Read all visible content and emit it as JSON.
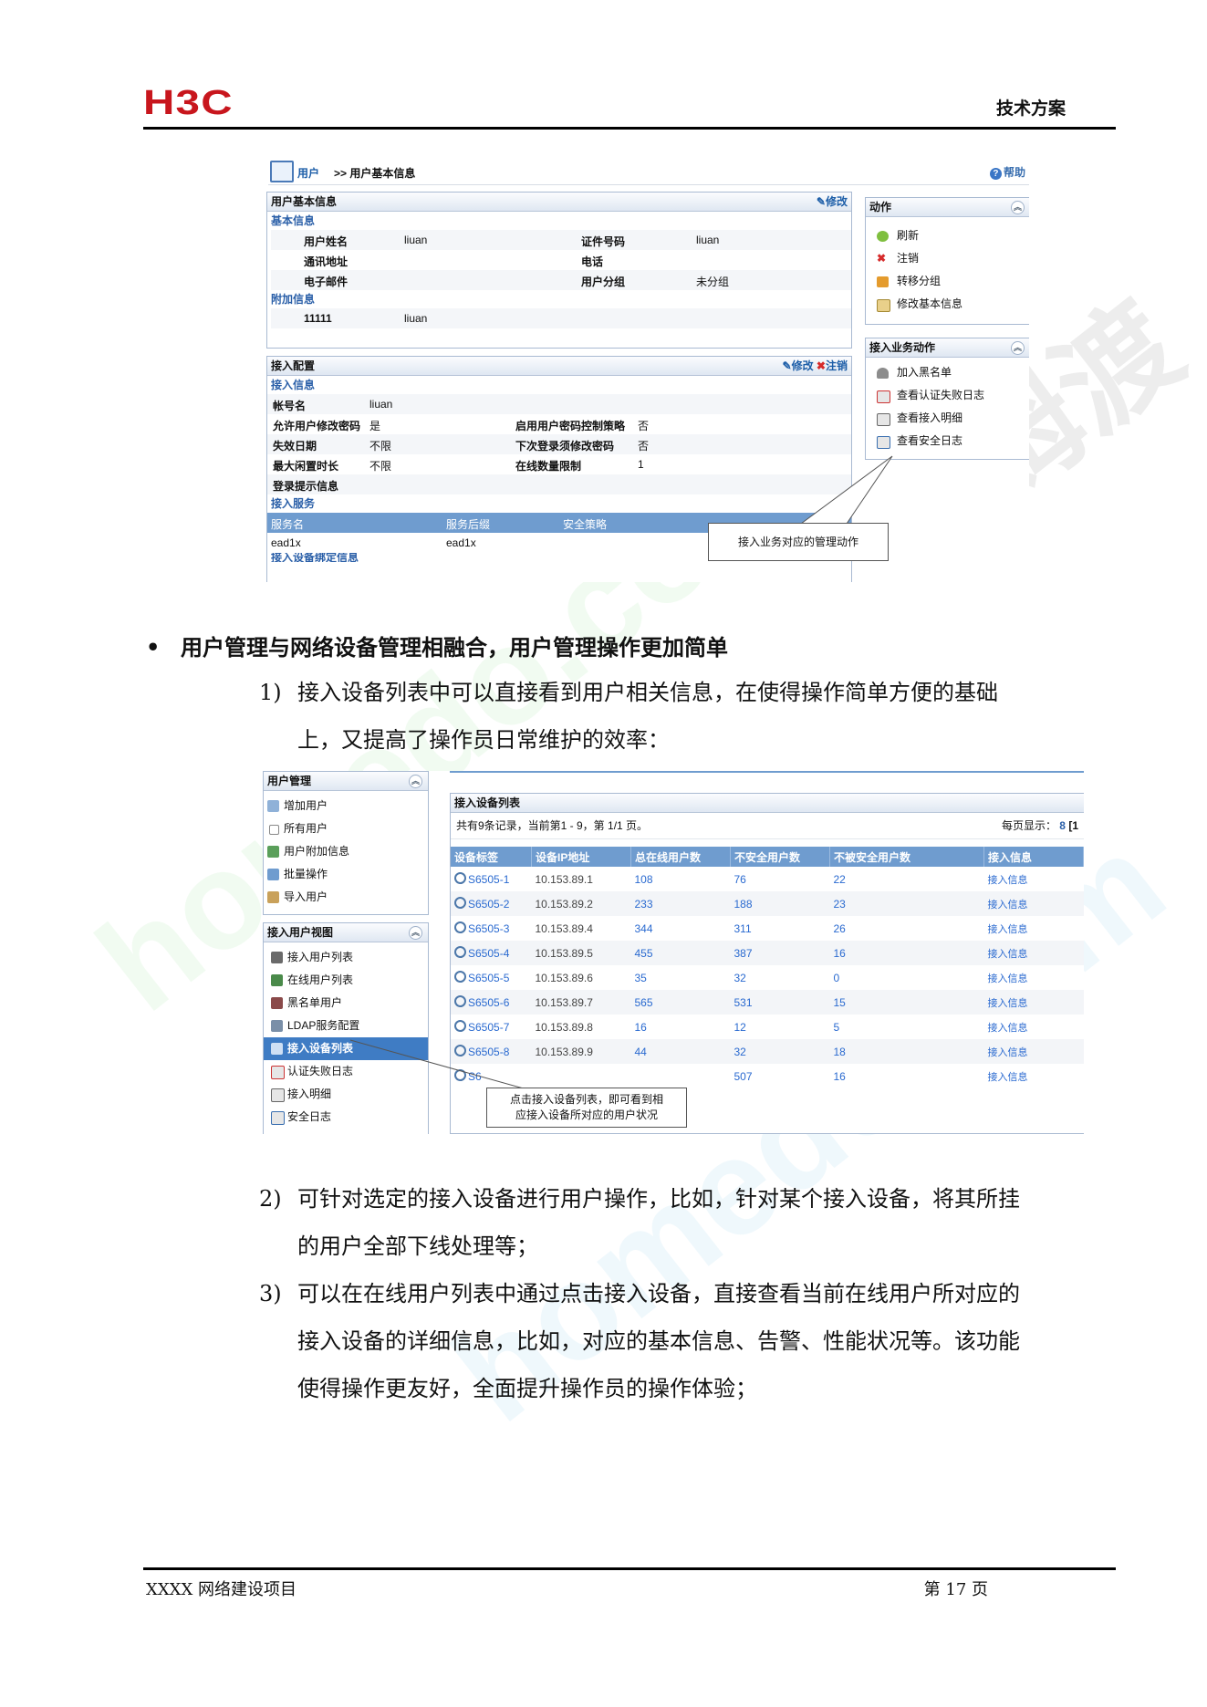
{
  "header": {
    "logo_text": "H3C",
    "doc_type": "技术方案"
  },
  "shot1": {
    "breadcrumb_link": "用户",
    "breadcrumb_current": ">> 用户基本信息",
    "help": "帮助",
    "user_panel": {
      "title": "用户基本信息",
      "edit": "修改",
      "basic_section": "基本信息",
      "rows": [
        {
          "k1": "用户姓名",
          "v1": "liuan",
          "k2": "证件号码",
          "v2": "liuan"
        },
        {
          "k1": "通讯地址",
          "v1": "",
          "k2": "电话",
          "v2": ""
        },
        {
          "k1": "电子邮件",
          "v1": "",
          "k2": "用户分组",
          "v2": "未分组"
        }
      ],
      "extra_section": "附加信息",
      "extra_row": {
        "k": "11111",
        "v": "liuan"
      }
    },
    "access_panel": {
      "title": "接入配置",
      "edit": "修改",
      "cancel": "注销",
      "info_section": "接入信息",
      "rows": [
        {
          "k1": "帐号名",
          "v1": "liuan",
          "k2": "",
          "v2": ""
        },
        {
          "k1": "允许用户修改密码",
          "v1": "是",
          "k2": "启用用户密码控制策略",
          "v2": "否"
        },
        {
          "k1": "失效日期",
          "v1": "不限",
          "k2": "下次登录须修改密码",
          "v2": "否"
        },
        {
          "k1": "最大闲置时长",
          "v1": "不限",
          "k2": "在线数量限制",
          "v2": "1"
        },
        {
          "k1": "登录提示信息",
          "v1": "",
          "k2": "",
          "v2": ""
        }
      ],
      "service_section": "接入服务",
      "service_headers": [
        "服务名",
        "服务后缀",
        "安全策略"
      ],
      "service_row": [
        "ead1x",
        "ead1x",
        ""
      ],
      "next_section": "接入设备绑定信息"
    },
    "actions_panel": {
      "title": "动作",
      "items": [
        "刷新",
        "注销",
        "转移分组",
        "修改基本信息"
      ]
    },
    "biz_panel": {
      "title": "接入业务动作",
      "items": [
        "加入黑名单",
        "查看认证失败日志",
        "查看接入明细",
        "查看安全日志"
      ]
    },
    "callout": "接入业务对应的管理动作"
  },
  "body": {
    "bullet": "用户管理与网络设备管理相融合，用户管理操作更加简单",
    "item1_num": "1)",
    "item1_line1": "接入设备列表中可以直接看到用户相关信息，在使得操作简单方便的基础",
    "item1_line2": "上，又提高了操作员日常维护的效率：",
    "item2_num": "2)",
    "item2_line1": "可针对选定的接入设备进行用户操作，比如，针对某个接入设备，将其所挂",
    "item2_line2": "的用户全部下线处理等；",
    "item3_num": "3)",
    "item3_line1": "可以在在线用户列表中通过点击接入设备，直接查看当前在线用户所对应的",
    "item3_line2": "接入设备的详细信息，比如，对应的基本信息、告警、性能状况等。该功能",
    "item3_line3": "使得操作更友好，全面提升操作员的操作体验；"
  },
  "shot2": {
    "user_mgmt": {
      "title": "用户管理",
      "items": [
        "增加用户",
        "所有用户",
        "用户附加信息",
        "批量操作",
        "导入用户"
      ]
    },
    "access_view": {
      "title": "接入用户视图",
      "items": [
        "接入用户列表",
        "在线用户列表",
        "黑名单用户",
        "LDAP服务配置",
        "接入设备列表",
        "认证失败日志",
        "接入明细",
        "安全日志"
      ],
      "selected_index": 4
    },
    "list": {
      "title": "接入设备列表",
      "summary": "共有9条记录，当前第1 - 9，第 1/1 页。",
      "per_page_label": "每页显示：",
      "per_page_value": "8",
      "per_page_more": "[1",
      "headers": [
        "设备标签",
        "设备IP地址",
        "总在线用户数",
        "不安全用户数",
        "不被安全用户数",
        "接入信息"
      ],
      "rows": [
        [
          "S6505-1",
          "10.153.89.1",
          "108",
          "76",
          "22",
          "接入信息"
        ],
        [
          "S6505-2",
          "10.153.89.2",
          "233",
          "188",
          "23",
          "接入信息"
        ],
        [
          "S6505-3",
          "10.153.89.4",
          "344",
          "311",
          "26",
          "接入信息"
        ],
        [
          "S6505-4",
          "10.153.89.5",
          "455",
          "387",
          "16",
          "接入信息"
        ],
        [
          "S6505-5",
          "10.153.89.6",
          "35",
          "32",
          "0",
          "接入信息"
        ],
        [
          "S6505-6",
          "10.153.89.7",
          "565",
          "531",
          "15",
          "接入信息"
        ],
        [
          "S6505-7",
          "10.153.89.8",
          "16",
          "12",
          "5",
          "接入信息"
        ],
        [
          "S6505-8",
          "10.153.89.9",
          "44",
          "32",
          "18",
          "接入信息"
        ],
        [
          "S6",
          "",
          "",
          "507",
          "16",
          "接入信息"
        ]
      ]
    },
    "callout_line1": "点击接入设备列表，即可看到相",
    "callout_line2": "应接入设备所对应的用户状况"
  },
  "footer": {
    "left": "XXXX 网络建设项目",
    "right": "第 17 页"
  },
  "watermark": {
    "text1": "homedo.com",
    "text2": "河姆渡"
  }
}
